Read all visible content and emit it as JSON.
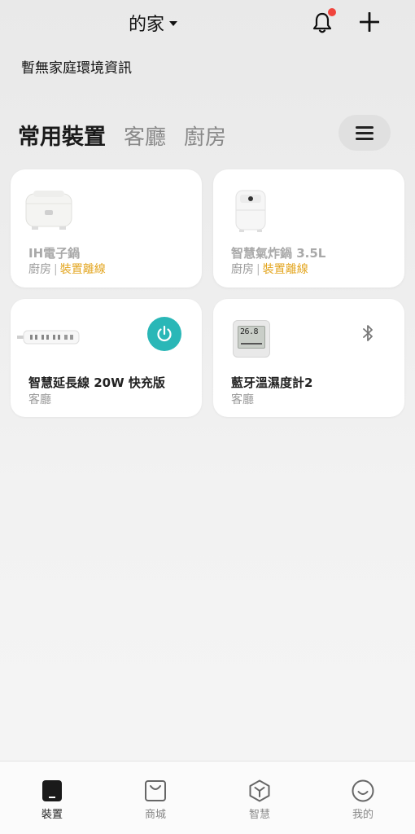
{
  "header": {
    "home_name": "的家",
    "env_info": "暫無家庭環境資訊",
    "accent_dot_color": "#f0443c"
  },
  "tabs": [
    {
      "label": "常用裝置",
      "active": true
    },
    {
      "label": "客廳",
      "active": false
    },
    {
      "label": "廚房",
      "active": false
    }
  ],
  "devices": [
    {
      "name": "IH電子鍋",
      "room": "廚房",
      "status": "裝置離線",
      "icon": "rice-cooker-icon"
    },
    {
      "name": "智慧氣炸鍋 3.5L",
      "room": "廚房",
      "status": "裝置離線",
      "icon": "air-fryer-icon"
    },
    {
      "name": "智慧延長線 20W 快充版",
      "room": "客廳",
      "icon": "power-strip-icon"
    },
    {
      "name": "藍牙溫濕度計2",
      "room": "客廳",
      "icon": "thermometer-icon",
      "display": "26.8"
    }
  ],
  "nav": [
    {
      "label": "裝置",
      "icon": "device-icon",
      "active": true
    },
    {
      "label": "商城",
      "icon": "shop-bag-icon",
      "active": false
    },
    {
      "label": "智慧",
      "icon": "smart-cube-icon",
      "active": false
    },
    {
      "label": "我的",
      "icon": "smiley-profile-icon",
      "active": false
    }
  ],
  "colors": {
    "power_accent": "#2ab7b7",
    "offline_status": "#e3a51f"
  }
}
